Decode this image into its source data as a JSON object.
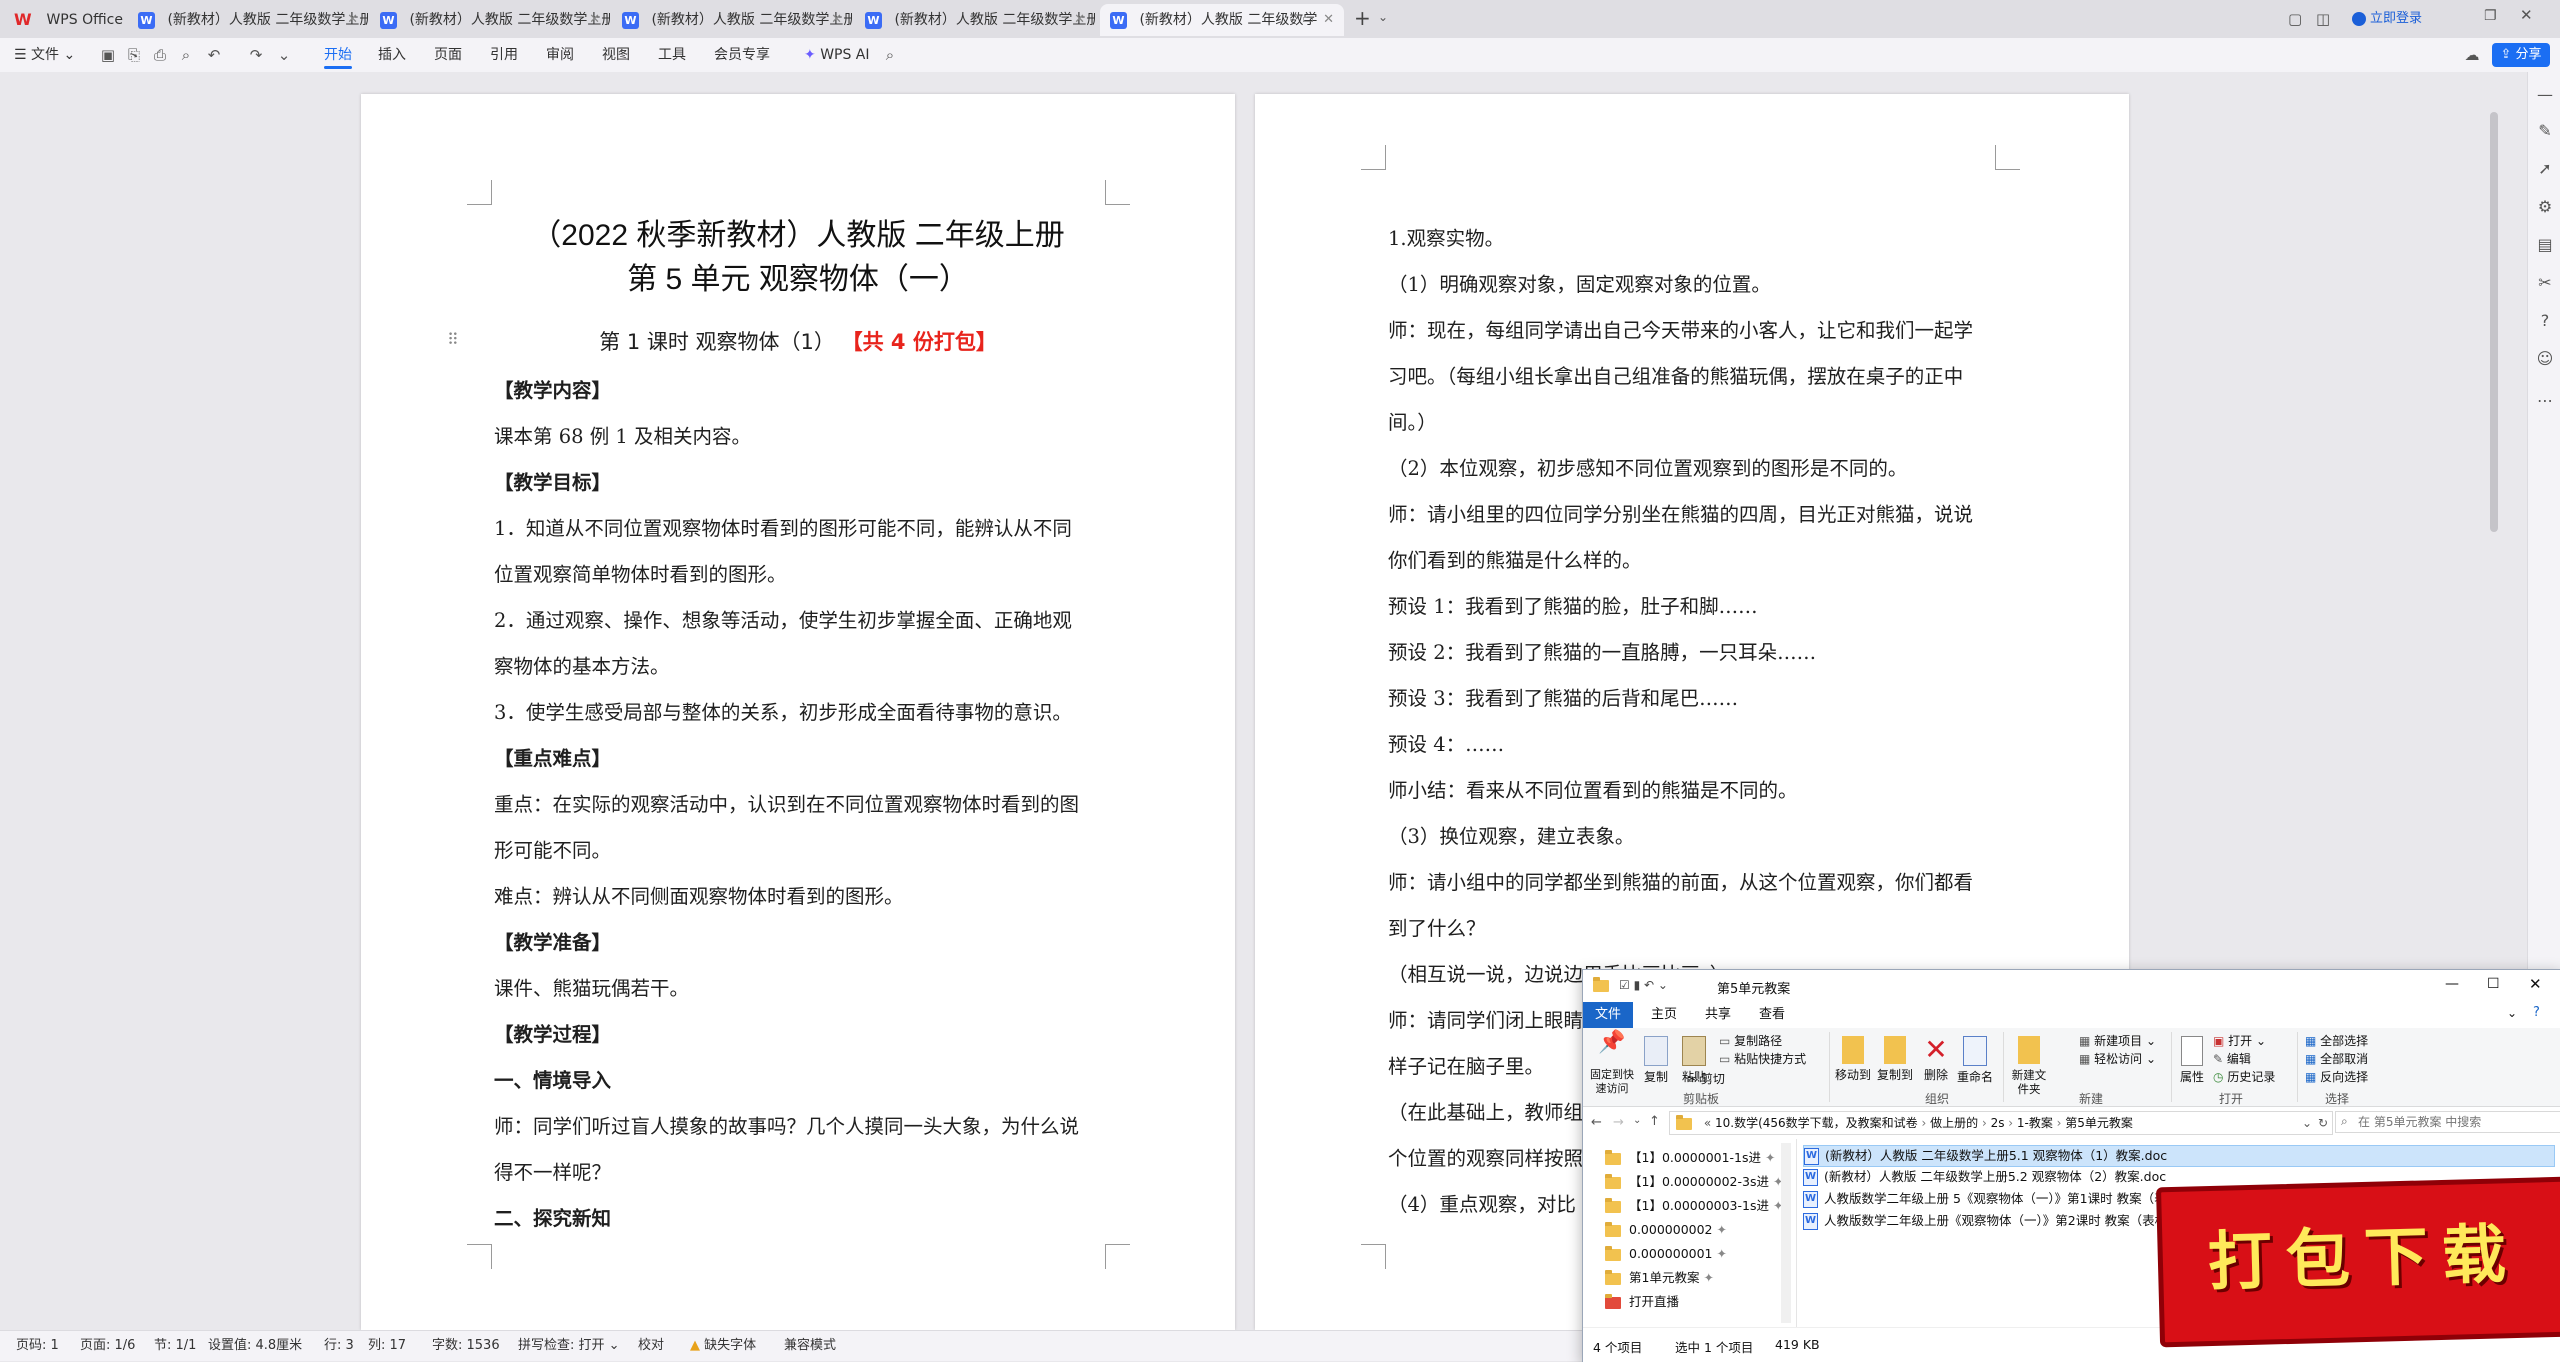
{
  "app": {
    "name": "WPS Office"
  },
  "tabs": [
    {
      "label": "(新教材）人教版 二年级数学上册"
    },
    {
      "label": "(新教材）人教版 二年级数学上册"
    },
    {
      "label": "(新教材）人教版 二年级数学上册"
    },
    {
      "label": "(新教材）人教版 二年级数学上册"
    },
    {
      "label": "(新教材）人教版 二年级数学"
    }
  ],
  "titlebar": {
    "login": "立即登录"
  },
  "ribbon": {
    "file": "文件",
    "menus": [
      "开始",
      "插入",
      "页面",
      "引用",
      "审阅",
      "视图",
      "工具",
      "会员专享"
    ],
    "wps_ai": "WPS AI",
    "share": "分享"
  },
  "page1": {
    "title1": "（2022 秋季新教材）人教版  二年级上册",
    "title2": "第 5 单元      观察物体（一）",
    "subtitle": "第 1 课时    观察物体（1）",
    "subtitle_red": "【共 4 份打包】",
    "lines": [
      "【教学内容】",
      "课本第 68 例 1 及相关内容。",
      "【教学目标】",
      "1．知道从不同位置观察物体时看到的图形可能不同，能辨认从不同",
      "位置观察简单物体时看到的图形。",
      "2．通过观察、操作、想象等活动，使学生初步掌握全面、正确地观",
      "察物体的基本方法。",
      "3．使学生感受局部与整体的关系，初步形成全面看待事物的意识。",
      "【重点难点】",
      "重点：在实际的观察活动中，认识到在不同位置观察物体时看到的图",
      "形可能不同。",
      "难点：辨认从不同侧面观察物体时看到的图形。",
      "【教学准备】",
      "课件、熊猫玩偶若干。",
      "【教学过程】",
      "一、情境导入",
      "师：同学们听过盲人摸象的故事吗？几个人摸同一头大象，为什么说",
      "得不一样呢？",
      "二、探究新知"
    ]
  },
  "page2": {
    "lines": [
      "1.观察实物。",
      "（1）明确观察对象，固定观察对象的位置。",
      "师：现在，每组同学请出自己今天带来的小客人，让它和我们一起学",
      "习吧。（每组小组长拿出自己组准备的熊猫玩偶，摆放在桌子的正中",
      "间。）",
      "（2）本位观察，初步感知不同位置观察到的图形是不同的。",
      "师：请小组里的四位同学分别坐在熊猫的四周，目光正对熊猫，说说",
      "你们看到的熊猫是什么样的。",
      "预设 1：我看到了熊猫的脸，肚子和脚……",
      "预设 2：我看到了熊猫的一直胳膊，一只耳朵……",
      "预设 3：我看到了熊猫的后背和尾巴……",
      "预设 4：……",
      "师小结：看来从不同位置看到的熊猫是不同的。",
      "（3）换位观察，建立表象。",
      "师：请小组中的同学都坐到熊猫的前面，从这个位置观察，你们都看",
      "到了什么？",
      "（相互说一说，边说边用手比画比画。）",
      "师：请同学们闭上眼睛",
      "样子记在脑子里。",
      "（在此基础上，教师组",
      "个位置的观察同样按照",
      "（4）重点观察，对比"
    ]
  },
  "status": {
    "page": "页码: 1",
    "pages": "页面: 1/6",
    "section": "节: 1/1",
    "setting": "设置值: 4.8厘米",
    "row": "行: 3",
    "col": "列: 17",
    "words": "字数: 1536",
    "spell": "拼写检查: 打开",
    "proof": "校对",
    "font_missing": "缺失字体",
    "compat": "兼容模式"
  },
  "explorer": {
    "title": "第5单元教案",
    "tabs": [
      "文件",
      "主页",
      "共享",
      "查看"
    ],
    "ribbon": {
      "pin": "固定到快速访问",
      "copy": "复制",
      "paste": "粘贴",
      "copy_path": "复制路径",
      "paste_shortcut": "粘贴快捷方式",
      "cut": "剪切",
      "move_to": "移动到",
      "copy_to": "复制到",
      "delete": "删除",
      "rename": "重命名",
      "new_folder": "新建文件夹",
      "new_item": "新建项目",
      "easy_access": "轻松访问",
      "properties": "属性",
      "open": "打开",
      "edit": "编辑",
      "history": "历史记录",
      "select_all": "全部选择",
      "select_none": "全部取消",
      "invert": "反向选择",
      "groups": [
        "剪贴板",
        "组织",
        "新建",
        "打开",
        "选择"
      ]
    },
    "address": [
      "10.数学(456数学下载，及教案和试卷",
      "做上册的",
      "2s",
      "1-教案",
      "第5单元教案"
    ],
    "search_placeholder": "在 第5单元教案 中搜索",
    "nav": [
      "【1】0.0000001-1s进",
      "【1】0.00000002-3s进",
      "【1】0.00000003-1s进",
      "0.000000002",
      "0.000000001",
      "第1单元教案",
      "打开直播"
    ],
    "files": [
      "(新教材）人教版 二年级数学上册5.1  观察物体（1）教案.doc",
      "(新教材）人教版 二年级数学上册5.2  观察物体（2）教案.doc",
      "人教版数学二年级上册 5《观察物体（一）》第1课时 教案（表格式）",
      "人教版数学二年级上册《观察物体（一）》第2课时 教案（表格式）"
    ],
    "status_count": "4 个项目",
    "status_selected": "选中 1 个项目",
    "status_size": "419 KB"
  },
  "stamp": {
    "text": "打包下载"
  }
}
